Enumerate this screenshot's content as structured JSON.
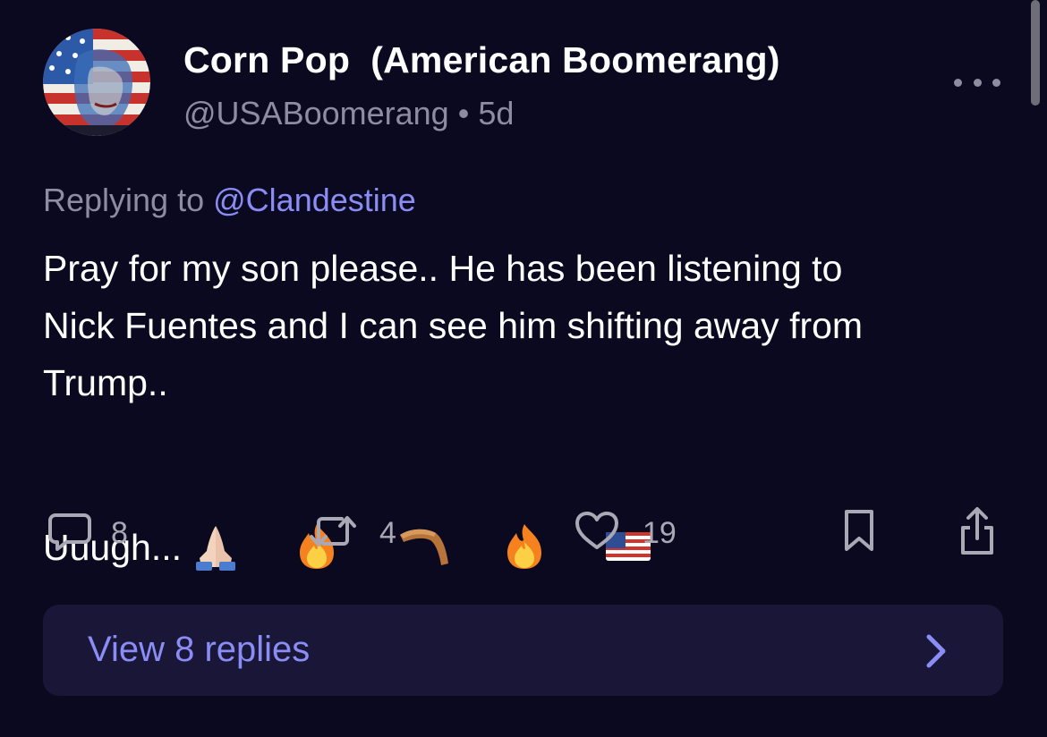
{
  "post": {
    "display_name": "Corn Pop  (American Boomerang)",
    "handle": "@USABoomerang",
    "separator": "•",
    "time_ago": "5d",
    "replying_label": "Replying to",
    "replying_to": "@Clandestine",
    "body_lines": [
      "Pray for my son please.. He has been listening to",
      "Nick Fuentes and I can see him shifting away from",
      "Trump..",
      "Uuugh..."
    ],
    "emojis": [
      "folded-hands-emoji",
      "fire-emoji",
      "boomerang-emoji",
      "fire-emoji",
      "us-flag-emoji"
    ]
  },
  "actions": {
    "replies": "8",
    "reposts": "4",
    "likes": "19"
  },
  "view_replies": {
    "label": "View 8 replies"
  },
  "colors": {
    "background": "#0b0920",
    "accent": "#8a8df5",
    "muted": "#8e8ca0",
    "card": "#1a1637"
  }
}
